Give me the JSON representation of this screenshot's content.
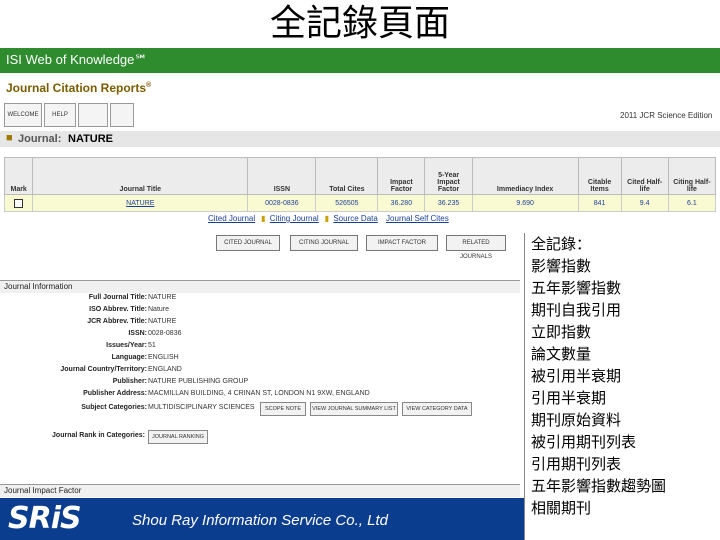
{
  "slide": {
    "title": "全記錄頁面"
  },
  "app": {
    "title": "ISI Web of Knowledge℠",
    "product": "Journal Citation Reports",
    "product_mark": "®",
    "edition": "2011 JCR Science Edition"
  },
  "toolbar": {
    "welcome": "WELCOME",
    "help": "HELP",
    "btn3": "",
    "btn4": ""
  },
  "journal": {
    "label": "Journal:",
    "name": "NATURE"
  },
  "table": {
    "headers": [
      "Mark",
      "Journal Title",
      "ISSN",
      "Total Cites",
      "Impact Factor",
      "5-Year Impact Factor",
      "Immediacy Index",
      "Citable Items",
      "Cited Half-life",
      "Citing Half-life"
    ],
    "row": [
      "",
      "NATURE",
      "0028-0836",
      "526505",
      "36.280",
      "36.235",
      "9.690",
      "841",
      "9.4",
      "6.1"
    ]
  },
  "cite_links": {
    "cited": "Cited Journal",
    "citing": "Citing Journal",
    "source": "Source Data",
    "self": "Journal Self Cites"
  },
  "actions": {
    "a1": "CITED JOURNAL",
    "a2": "CITING JOURNAL",
    "a3": "IMPACT FACTOR",
    "a4": "RELATED JOURNALS"
  },
  "sections": {
    "info": "Journal Information",
    "impact": "Journal Impact Factor"
  },
  "info": {
    "full_title_label": "Full Journal Title:",
    "full_title": "NATURE",
    "iso_label": "ISO Abbrev. Title:",
    "iso": "Nature",
    "jcr_label": "JCR Abbrev. Title:",
    "jcr": "NATURE",
    "issn_label": "ISSN:",
    "issn": "0028-0836",
    "issues_label": "Issues/Year:",
    "issues": "51",
    "language_label": "Language:",
    "language": "ENGLISH",
    "country_label": "Journal Country/Territory:",
    "country": "ENGLAND",
    "publisher_label": "Publisher:",
    "publisher": "NATURE PUBLISHING GROUP",
    "address_label": "Publisher Address:",
    "address": "MACMILLAN BUILDING, 4 CRINAN ST, LONDON N1 9XW, ENGLAND",
    "subject_label": "Subject Categories:",
    "subject": "MULTIDISCIPLINARY SCIENCES",
    "scope_btn": "SCOPE NOTE",
    "summary_btn": "VIEW JOURNAL SUMMARY LIST",
    "category_btn": "VIEW CATEGORY DATA",
    "rank_label": "Journal Rank in Categories:",
    "rank_btn": "JOURNAL RANKING"
  },
  "callout": {
    "heading": "全記錄：",
    "items": [
      "影響指數",
      "五年影響指數",
      "期刊自我引用",
      "立即指數",
      "論文數量",
      "被引用半衰期",
      "引用半衰期",
      "期刊原始資料",
      "被引用期刊列表",
      "引用期刊列表",
      "五年影響指數趨勢圖",
      "相關期刊"
    ]
  },
  "footer": {
    "logo": "SRiS",
    "company": "Shou Ray Information Service Co., Ltd"
  },
  "colors": {
    "isi_green": "#2e8b2e",
    "footer_blue": "#0b3d8f",
    "row_highlight": "#fafad2"
  }
}
